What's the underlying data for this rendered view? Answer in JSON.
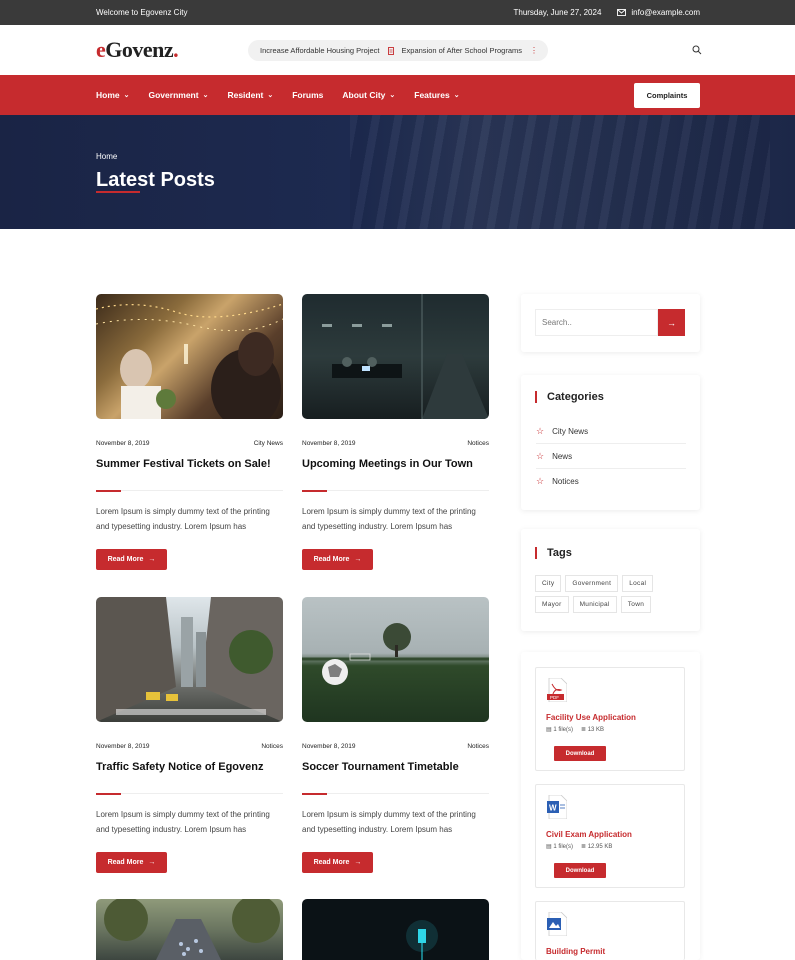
{
  "topbar": {
    "welcome": "Welcome to Egovenz City",
    "date": "Thursday, June 27, 2024",
    "email": "info@example.com"
  },
  "logo": {
    "e": "e",
    "rest": "Govenz",
    "dot": "."
  },
  "ticker": {
    "item1": "Increase Affordable Housing Project",
    "item2": "Expansion of After School Programs"
  },
  "nav": {
    "items": [
      {
        "label": "Home",
        "dropdown": true
      },
      {
        "label": "Government",
        "dropdown": true
      },
      {
        "label": "Resident",
        "dropdown": true
      },
      {
        "label": "Forums",
        "dropdown": false
      },
      {
        "label": "About City",
        "dropdown": true
      },
      {
        "label": "Features",
        "dropdown": true
      }
    ],
    "button": "Complaints"
  },
  "hero": {
    "breadcrumb": "Home",
    "title": "Latest Posts"
  },
  "posts": [
    {
      "date": "November 8, 2019",
      "category": "City News",
      "title": "Summer Festival Tickets on Sale!",
      "excerpt": "Lorem Ipsum is simply dummy text of the printing and typesetting industry. Lorem Ipsum has",
      "button": "Read More"
    },
    {
      "date": "November 8, 2019",
      "category": "Notices",
      "title": "Upcoming Meetings in Our Town",
      "excerpt": "Lorem Ipsum is simply dummy text of the printing and typesetting industry. Lorem Ipsum has",
      "button": "Read More"
    },
    {
      "date": "November 8, 2019",
      "category": "Notices",
      "title": "Traffic Safety Notice of Egovenz",
      "excerpt": "Lorem Ipsum is simply dummy text of the printing and typesetting industry. Lorem Ipsum has",
      "button": "Read More"
    },
    {
      "date": "November 8, 2019",
      "category": "Notices",
      "title": "Soccer Tournament Timetable",
      "excerpt": "Lorem Ipsum is simply dummy text of the printing and typesetting industry. Lorem Ipsum has",
      "button": "Read More"
    }
  ],
  "sidebar": {
    "search_placeholder": "Search..",
    "categories_title": "Categories",
    "categories": [
      "City News",
      "News",
      "Notices"
    ],
    "tags_title": "Tags",
    "tags": [
      "City",
      "Government",
      "Local",
      "Mayor",
      "Municipal",
      "Town"
    ],
    "files": [
      {
        "title": "Facility Use Application",
        "files": "1 file(s)",
        "size": "13 KB",
        "button": "Download",
        "icon": "pdf-icon",
        "badge": "PDF"
      },
      {
        "title": "Civil Exam Application",
        "files": "1 file(s)",
        "size": "12.95 KB",
        "button": "Download",
        "icon": "word-icon",
        "badge": "W"
      },
      {
        "title": "Building Permit",
        "icon": "image-file-icon"
      }
    ]
  },
  "colors": {
    "accent": "#c62b2e",
    "hero": "#1a2445",
    "topbar": "#3a3a3a"
  }
}
